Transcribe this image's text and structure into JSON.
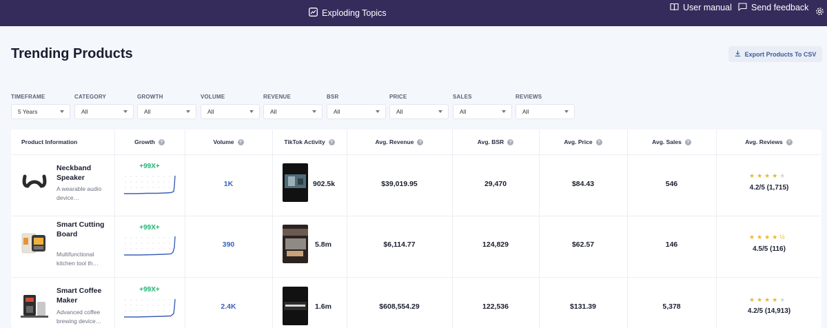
{
  "topbar": {
    "brand": "Exploding Topics",
    "user_manual": "User manual",
    "send_feedback": "Send feedback"
  },
  "header": {
    "title": "Trending Products",
    "export_label": "Export Products To CSV"
  },
  "filters": [
    {
      "label": "TIMEFRAME",
      "value": "5 Years"
    },
    {
      "label": "CATEGORY",
      "value": "All"
    },
    {
      "label": "GROWTH",
      "value": "All"
    },
    {
      "label": "VOLUME",
      "value": "All"
    },
    {
      "label": "REVENUE",
      "value": "All"
    },
    {
      "label": "BSR",
      "value": "All"
    },
    {
      "label": "PRICE",
      "value": "All"
    },
    {
      "label": "SALES",
      "value": "All"
    },
    {
      "label": "REVIEWS",
      "value": "All"
    }
  ],
  "table": {
    "columns": [
      "Product Information",
      "Growth",
      "Volume",
      "TikTok Activity",
      "Avg. Revenue",
      "Avg. BSR",
      "Avg. Price",
      "Avg. Sales",
      "Avg. Reviews"
    ],
    "rows": [
      {
        "name": "Neckband Speaker",
        "desc": "A wearable audio device…",
        "growth": "+99X+",
        "volume": "1K",
        "tiktok": "902.5k",
        "revenue": "$39,019.95",
        "bsr": "29,470",
        "price": "$84.43",
        "sales": "546",
        "rating": 4.2,
        "reviews": "4.2/5 (1,715)"
      },
      {
        "name": "Smart Cutting Board",
        "desc": "Multifunctional kitchen tool th…",
        "growth": "+99X+",
        "volume": "390",
        "tiktok": "5.8m",
        "revenue": "$6,114.77",
        "bsr": "124,829",
        "price": "$62.57",
        "sales": "146",
        "rating": 4.5,
        "reviews": "4.5/5 (116)"
      },
      {
        "name": "Smart Coffee Maker",
        "desc": "Advanced coffee brewing device…",
        "growth": "+99X+",
        "volume": "2.4K",
        "tiktok": "1.6m",
        "revenue": "$608,554.29",
        "bsr": "122,536",
        "price": "$131.39",
        "sales": "5,378",
        "rating": 4.2,
        "reviews": "4.2/5 (14,913)"
      }
    ]
  },
  "colors": {
    "topbar": "#352c5c",
    "growth_green": "#22b573",
    "volume_blue": "#3864b8",
    "star_gold": "#e8b830"
  }
}
